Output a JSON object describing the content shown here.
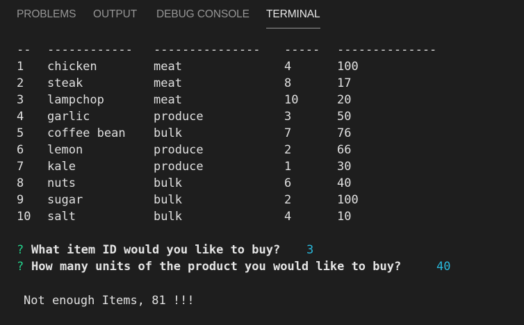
{
  "tabs": [
    {
      "label": "PROBLEMS",
      "active": false
    },
    {
      "label": "OUTPUT",
      "active": false
    },
    {
      "label": "DEBUG CONSOLE",
      "active": false
    },
    {
      "label": "TERMINAL",
      "active": true
    }
  ],
  "table": {
    "separator": [
      "--",
      "------------",
      "---------------",
      "-----",
      "--------------"
    ],
    "rows": [
      [
        "1",
        "chicken",
        "meat",
        "4",
        "100"
      ],
      [
        "2",
        "steak",
        "meat",
        "8",
        "17"
      ],
      [
        "3",
        "lampchop",
        "meat",
        "10",
        "20"
      ],
      [
        "4",
        "garlic",
        "produce",
        "3",
        "50"
      ],
      [
        "5",
        "coffee bean",
        "bulk",
        "7",
        "76"
      ],
      [
        "6",
        "lemon",
        "produce",
        "2",
        "66"
      ],
      [
        "7",
        "kale",
        "produce",
        "1",
        "30"
      ],
      [
        "8",
        "nuts",
        "bulk",
        "6",
        "40"
      ],
      [
        "9",
        "sugar",
        "bulk",
        "2",
        "100"
      ],
      [
        "10",
        "salt",
        "bulk",
        "4",
        "10"
      ]
    ]
  },
  "prompts": [
    {
      "mark": "?",
      "question": "What item ID would you like to buy?",
      "answer": "3"
    },
    {
      "mark": "?",
      "question": "How many units of the product you would like to buy?",
      "answer": "40"
    }
  ],
  "message": "Not enough Items, 81 !!!",
  "colors": {
    "background": "#1e1e1e",
    "text": "#e0e0e0",
    "prompt_mark": "#23d18b",
    "answer": "#29b8db",
    "tab_inactive": "#969696",
    "tab_active": "#e7e7e7"
  }
}
